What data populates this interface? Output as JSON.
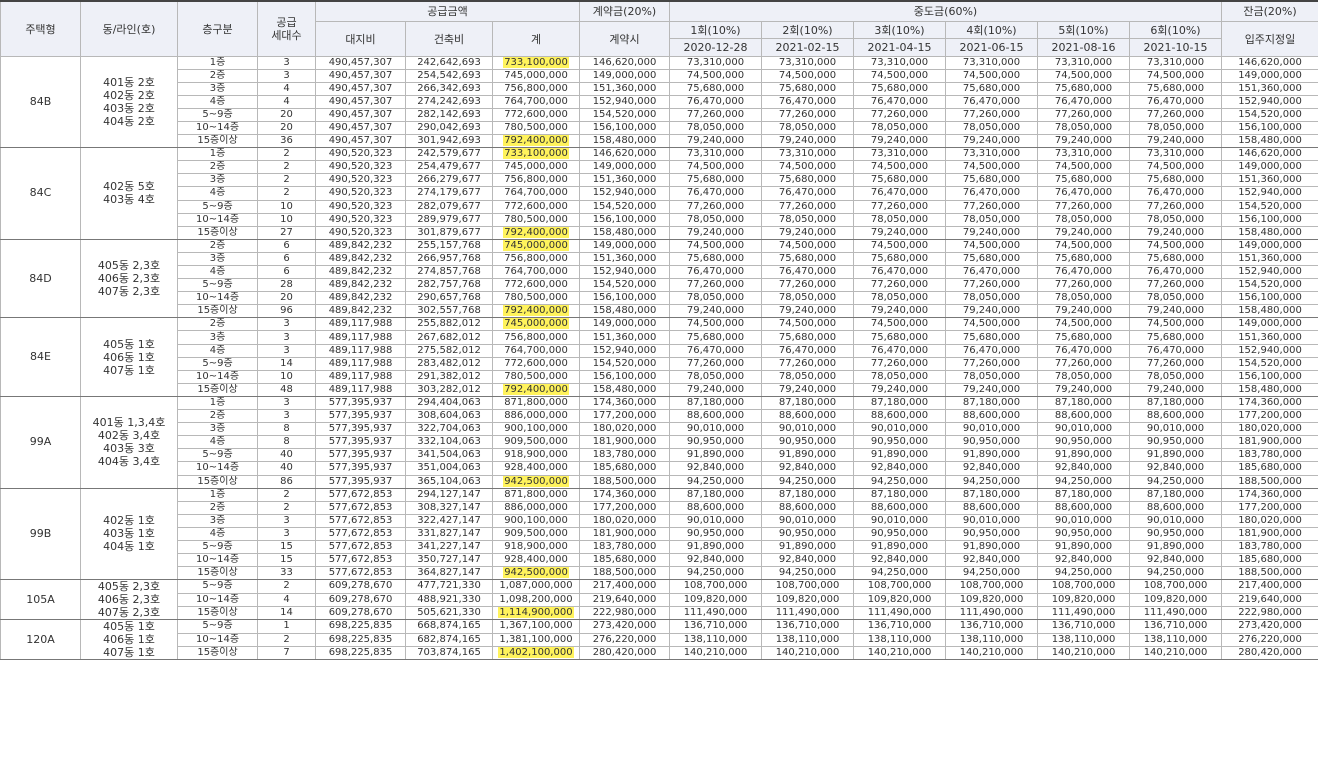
{
  "header": {
    "house_type": "주택형",
    "dong_line": "동/라인(호)",
    "floor_div": "층구분",
    "supply_units": [
      "공급",
      "세대수"
    ],
    "supply_price": "공급금액",
    "land": "대지비",
    "building": "건축비",
    "total": "계",
    "contract": "계약금(20%)",
    "contract_sub": "계약시",
    "middle": "중도금(60%)",
    "installments": [
      {
        "label": "1회(10%)",
        "date": "2020-12-28"
      },
      {
        "label": "2회(10%)",
        "date": "2021-02-15"
      },
      {
        "label": "3회(10%)",
        "date": "2021-04-15"
      },
      {
        "label": "4회(10%)",
        "date": "2021-06-15"
      },
      {
        "label": "5회(10%)",
        "date": "2021-08-16"
      },
      {
        "label": "6회(10%)",
        "date": "2021-10-15"
      }
    ],
    "balance": "잔금(20%)",
    "balance_sub": "입주지정일"
  },
  "colors": {
    "highlight": "#fff35c",
    "header_bg": "#eef0f7",
    "border": "#b8b8b8"
  },
  "groups": [
    {
      "type": "84B",
      "dong": [
        "401동 2호",
        "402동 2호",
        "403동 2호",
        "404동 2호"
      ],
      "rows": [
        [
          "1층",
          "3",
          "490,457,307",
          "242,642,693",
          "733,100,000",
          "146,620,000",
          "73,310,000",
          "146,620,000",
          1
        ],
        [
          "2층",
          "3",
          "490,457,307",
          "254,542,693",
          "745,000,000",
          "149,000,000",
          "74,500,000",
          "149,000,000",
          0
        ],
        [
          "3층",
          "4",
          "490,457,307",
          "266,342,693",
          "756,800,000",
          "151,360,000",
          "75,680,000",
          "151,360,000",
          0
        ],
        [
          "4층",
          "4",
          "490,457,307",
          "274,242,693",
          "764,700,000",
          "152,940,000",
          "76,470,000",
          "152,940,000",
          0
        ],
        [
          "5~9층",
          "20",
          "490,457,307",
          "282,142,693",
          "772,600,000",
          "154,520,000",
          "77,260,000",
          "154,520,000",
          0
        ],
        [
          "10~14층",
          "20",
          "490,457,307",
          "290,042,693",
          "780,500,000",
          "156,100,000",
          "78,050,000",
          "156,100,000",
          0
        ],
        [
          "15층이상",
          "36",
          "490,457,307",
          "301,942,693",
          "792,400,000",
          "158,480,000",
          "79,240,000",
          "158,480,000",
          1
        ]
      ]
    },
    {
      "type": "84C",
      "dong": [
        "402동 5호",
        "403동 4호"
      ],
      "rows": [
        [
          "1층",
          "2",
          "490,520,323",
          "242,579,677",
          "733,100,000",
          "146,620,000",
          "73,310,000",
          "146,620,000",
          1
        ],
        [
          "2층",
          "2",
          "490,520,323",
          "254,479,677",
          "745,000,000",
          "149,000,000",
          "74,500,000",
          "149,000,000",
          0
        ],
        [
          "3층",
          "2",
          "490,520,323",
          "266,279,677",
          "756,800,000",
          "151,360,000",
          "75,680,000",
          "151,360,000",
          0
        ],
        [
          "4층",
          "2",
          "490,520,323",
          "274,179,677",
          "764,700,000",
          "152,940,000",
          "76,470,000",
          "152,940,000",
          0
        ],
        [
          "5~9층",
          "10",
          "490,520,323",
          "282,079,677",
          "772,600,000",
          "154,520,000",
          "77,260,000",
          "154,520,000",
          0
        ],
        [
          "10~14층",
          "10",
          "490,520,323",
          "289,979,677",
          "780,500,000",
          "156,100,000",
          "78,050,000",
          "156,100,000",
          0
        ],
        [
          "15층이상",
          "27",
          "490,520,323",
          "301,879,677",
          "792,400,000",
          "158,480,000",
          "79,240,000",
          "158,480,000",
          1
        ]
      ]
    },
    {
      "type": "84D",
      "dong": [
        "405동 2,3호",
        "406동 2,3호",
        "407동 2,3호"
      ],
      "rows": [
        [
          "2층",
          "6",
          "489,842,232",
          "255,157,768",
          "745,000,000",
          "149,000,000",
          "74,500,000",
          "149,000,000",
          1
        ],
        [
          "3층",
          "6",
          "489,842,232",
          "266,957,768",
          "756,800,000",
          "151,360,000",
          "75,680,000",
          "151,360,000",
          0
        ],
        [
          "4층",
          "6",
          "489,842,232",
          "274,857,768",
          "764,700,000",
          "152,940,000",
          "76,470,000",
          "152,940,000",
          0
        ],
        [
          "5~9층",
          "28",
          "489,842,232",
          "282,757,768",
          "772,600,000",
          "154,520,000",
          "77,260,000",
          "154,520,000",
          0
        ],
        [
          "10~14층",
          "20",
          "489,842,232",
          "290,657,768",
          "780,500,000",
          "156,100,000",
          "78,050,000",
          "156,100,000",
          0
        ],
        [
          "15층이상",
          "96",
          "489,842,232",
          "302,557,768",
          "792,400,000",
          "158,480,000",
          "79,240,000",
          "158,480,000",
          1
        ]
      ]
    },
    {
      "type": "84E",
      "dong": [
        "405동 1호",
        "406동 1호",
        "407동 1호"
      ],
      "rows": [
        [
          "2층",
          "3",
          "489,117,988",
          "255,882,012",
          "745,000,000",
          "149,000,000",
          "74,500,000",
          "149,000,000",
          1
        ],
        [
          "3층",
          "3",
          "489,117,988",
          "267,682,012",
          "756,800,000",
          "151,360,000",
          "75,680,000",
          "151,360,000",
          0
        ],
        [
          "4층",
          "3",
          "489,117,988",
          "275,582,012",
          "764,700,000",
          "152,940,000",
          "76,470,000",
          "152,940,000",
          0
        ],
        [
          "5~9층",
          "14",
          "489,117,988",
          "283,482,012",
          "772,600,000",
          "154,520,000",
          "77,260,000",
          "154,520,000",
          0
        ],
        [
          "10~14층",
          "10",
          "489,117,988",
          "291,382,012",
          "780,500,000",
          "156,100,000",
          "78,050,000",
          "156,100,000",
          0
        ],
        [
          "15층이상",
          "48",
          "489,117,988",
          "303,282,012",
          "792,400,000",
          "158,480,000",
          "79,240,000",
          "158,480,000",
          1
        ]
      ]
    },
    {
      "type": "99A",
      "dong": [
        "401동 1,3,4호",
        "402동 3,4호",
        "403동 3호",
        "404동 3,4호"
      ],
      "rows": [
        [
          "1층",
          "3",
          "577,395,937",
          "294,404,063",
          "871,800,000",
          "174,360,000",
          "87,180,000",
          "174,360,000",
          0
        ],
        [
          "2층",
          "3",
          "577,395,937",
          "308,604,063",
          "886,000,000",
          "177,200,000",
          "88,600,000",
          "177,200,000",
          0
        ],
        [
          "3층",
          "8",
          "577,395,937",
          "322,704,063",
          "900,100,000",
          "180,020,000",
          "90,010,000",
          "180,020,000",
          0
        ],
        [
          "4층",
          "8",
          "577,395,937",
          "332,104,063",
          "909,500,000",
          "181,900,000",
          "90,950,000",
          "181,900,000",
          0
        ],
        [
          "5~9층",
          "40",
          "577,395,937",
          "341,504,063",
          "918,900,000",
          "183,780,000",
          "91,890,000",
          "183,780,000",
          0
        ],
        [
          "10~14층",
          "40",
          "577,395,937",
          "351,004,063",
          "928,400,000",
          "185,680,000",
          "92,840,000",
          "185,680,000",
          0
        ],
        [
          "15층이상",
          "86",
          "577,395,937",
          "365,104,063",
          "942,500,000",
          "188,500,000",
          "94,250,000",
          "188,500,000",
          1
        ]
      ]
    },
    {
      "type": "99B",
      "dong": [
        "402동 1호",
        "403동 1호",
        "404동 1호"
      ],
      "rows": [
        [
          "1층",
          "2",
          "577,672,853",
          "294,127,147",
          "871,800,000",
          "174,360,000",
          "87,180,000",
          "174,360,000",
          0
        ],
        [
          "2층",
          "2",
          "577,672,853",
          "308,327,147",
          "886,000,000",
          "177,200,000",
          "88,600,000",
          "177,200,000",
          0
        ],
        [
          "3층",
          "3",
          "577,672,853",
          "322,427,147",
          "900,100,000",
          "180,020,000",
          "90,010,000",
          "180,020,000",
          0
        ],
        [
          "4층",
          "3",
          "577,672,853",
          "331,827,147",
          "909,500,000",
          "181,900,000",
          "90,950,000",
          "181,900,000",
          0
        ],
        [
          "5~9층",
          "15",
          "577,672,853",
          "341,227,147",
          "918,900,000",
          "183,780,000",
          "91,890,000",
          "183,780,000",
          0
        ],
        [
          "10~14층",
          "15",
          "577,672,853",
          "350,727,147",
          "928,400,000",
          "185,680,000",
          "92,840,000",
          "185,680,000",
          0
        ],
        [
          "15층이상",
          "33",
          "577,672,853",
          "364,827,147",
          "942,500,000",
          "188,500,000",
          "94,250,000",
          "188,500,000",
          1
        ]
      ]
    },
    {
      "type": "105A",
      "dong": [
        "405동 2,3호",
        "406동 2,3호",
        "407동 2,3호"
      ],
      "rows": [
        [
          "5~9층",
          "2",
          "609,278,670",
          "477,721,330",
          "1,087,000,000",
          "217,400,000",
          "108,700,000",
          "217,400,000",
          0
        ],
        [
          "10~14층",
          "4",
          "609,278,670",
          "488,921,330",
          "1,098,200,000",
          "219,640,000",
          "109,820,000",
          "219,640,000",
          0
        ],
        [
          "15층이상",
          "14",
          "609,278,670",
          "505,621,330",
          "1,114,900,000",
          "222,980,000",
          "111,490,000",
          "222,980,000",
          1
        ]
      ]
    },
    {
      "type": "120A",
      "dong": [
        "405동 1호",
        "406동 1호",
        "407동 1호"
      ],
      "rows": [
        [
          "5~9층",
          "1",
          "698,225,835",
          "668,874,165",
          "1,367,100,000",
          "273,420,000",
          "136,710,000",
          "273,420,000",
          0
        ],
        [
          "10~14층",
          "2",
          "698,225,835",
          "682,874,165",
          "1,381,100,000",
          "276,220,000",
          "138,110,000",
          "276,220,000",
          0
        ],
        [
          "15층이상",
          "7",
          "698,225,835",
          "703,874,165",
          "1,402,100,000",
          "280,420,000",
          "140,210,000",
          "280,420,000",
          1
        ]
      ]
    }
  ]
}
